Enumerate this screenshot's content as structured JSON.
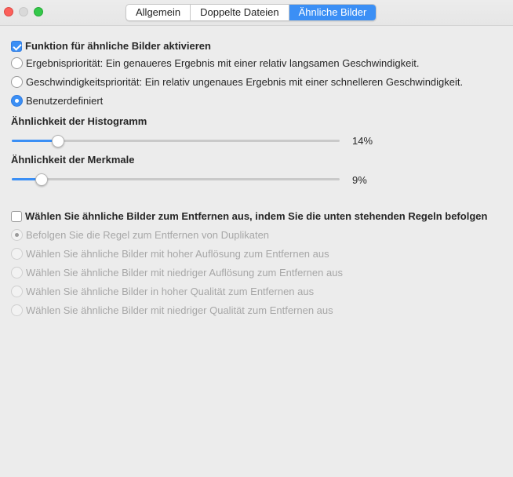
{
  "tabs": [
    {
      "label": "Allgemein",
      "active": false
    },
    {
      "label": "Doppelte Dateien",
      "active": false
    },
    {
      "label": "Ähnliche Bilder",
      "active": true
    }
  ],
  "enable_similar": {
    "label": "Funktion für ähnliche Bilder aktivieren",
    "checked": true
  },
  "priority_options": [
    {
      "label": "Ergebnispriorität: Ein genaueres Ergebnis mit einer relativ langsamen Geschwindigkeit.",
      "checked": false
    },
    {
      "label": "Geschwindigkeitspriorität: Ein relativ ungenaues Ergebnis mit einer schnelleren Geschwindigkeit.",
      "checked": false
    },
    {
      "label": "Benutzerdefiniert",
      "checked": true
    }
  ],
  "histogram": {
    "title": "Ähnlichkeit der Histogramm",
    "value": 14,
    "value_label": "14%"
  },
  "features": {
    "title": "Ähnlichkeit der Merkmale",
    "value": 9,
    "value_label": "9%"
  },
  "remove_rules": {
    "label": "Wählen Sie ähnliche Bilder zum Entfernen aus, indem Sie die unten stehenden Regeln befolgen",
    "checked": false
  },
  "rule_options": [
    {
      "label": "Befolgen Sie die Regel zum Entfernen von Duplikaten",
      "checked": true
    },
    {
      "label": "Wählen Sie ähnliche Bilder mit hoher Auflösung zum Entfernen aus",
      "checked": false
    },
    {
      "label": "Wählen Sie ähnliche Bilder mit niedriger Auflösung zum Entfernen aus",
      "checked": false
    },
    {
      "label": "Wählen Sie ähnliche Bilder in hoher Qualität zum Entfernen aus",
      "checked": false
    },
    {
      "label": "Wählen Sie ähnliche Bilder mit niedriger Qualität zum Entfernen aus",
      "checked": false
    }
  ],
  "colors": {
    "accent": "#3b8ff5"
  }
}
